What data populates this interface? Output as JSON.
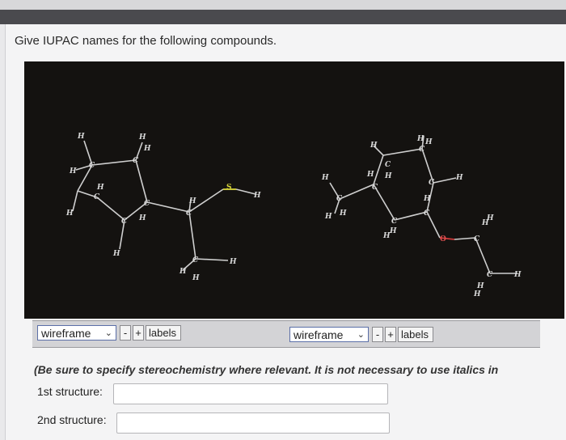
{
  "question": "Give IUPAC names for the following compounds.",
  "viewer_left": {
    "mode": "wireframe",
    "minus": "-",
    "plus": "+",
    "labels": "labels"
  },
  "viewer_right": {
    "mode": "wireframe",
    "minus": "-",
    "plus": "+",
    "labels": "labels"
  },
  "note": "(Be sure to specify stereochemistry where relevant. It is not necessary to use italics in",
  "answers": [
    {
      "label": "1st structure:",
      "value": ""
    },
    {
      "label": "2nd structure:",
      "value": ""
    }
  ],
  "atoms": {
    "H": "H",
    "C": "C",
    "S": "S",
    "O": "O"
  }
}
